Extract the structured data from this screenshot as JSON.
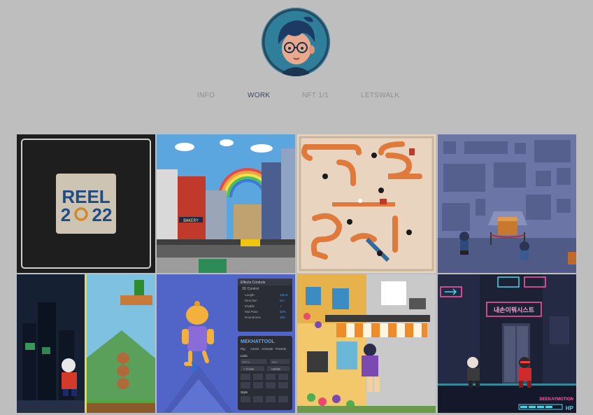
{
  "nav": {
    "items": [
      {
        "label": "INFO",
        "active": false
      },
      {
        "label": "WORK",
        "active": true
      },
      {
        "label": "NFT 1/1",
        "active": false
      },
      {
        "label": "LETSWALK",
        "active": false
      }
    ]
  },
  "tiles": {
    "reel": {
      "line1": "REEL",
      "line2_a": "2",
      "line2_b": "22"
    },
    "city": {
      "sign": "BAKERY"
    },
    "tool": {
      "panel_title": "Effects Controls",
      "group": "3D Control",
      "params": [
        {
          "name": "Length",
          "value": "100.0"
        },
        {
          "name": "Direction",
          "value": "0x+"
        },
        {
          "name": "Enable",
          "value": "✓"
        },
        {
          "name": "Mid Point",
          "value": "50%"
        },
        {
          "name": "Roundness",
          "value": "100"
        }
      ],
      "brand": "MEKHATTOOL",
      "menu": [
        "Rig",
        "Assist",
        "Animate",
        "Presets"
      ],
      "limb_label": "Limb",
      "name_placeholder": "Name...",
      "type_label": "Type",
      "create_label": "+ Create",
      "update_label": "Update",
      "style_label": "Style"
    },
    "neon": {
      "sign": "내손이뭐시스트",
      "credit": "DEEKAYMOTION",
      "hp": "HP"
    }
  },
  "colors": {
    "background": "#bebebe",
    "nav_inactive": "#8e8e8e",
    "nav_active": "#3f4855"
  }
}
